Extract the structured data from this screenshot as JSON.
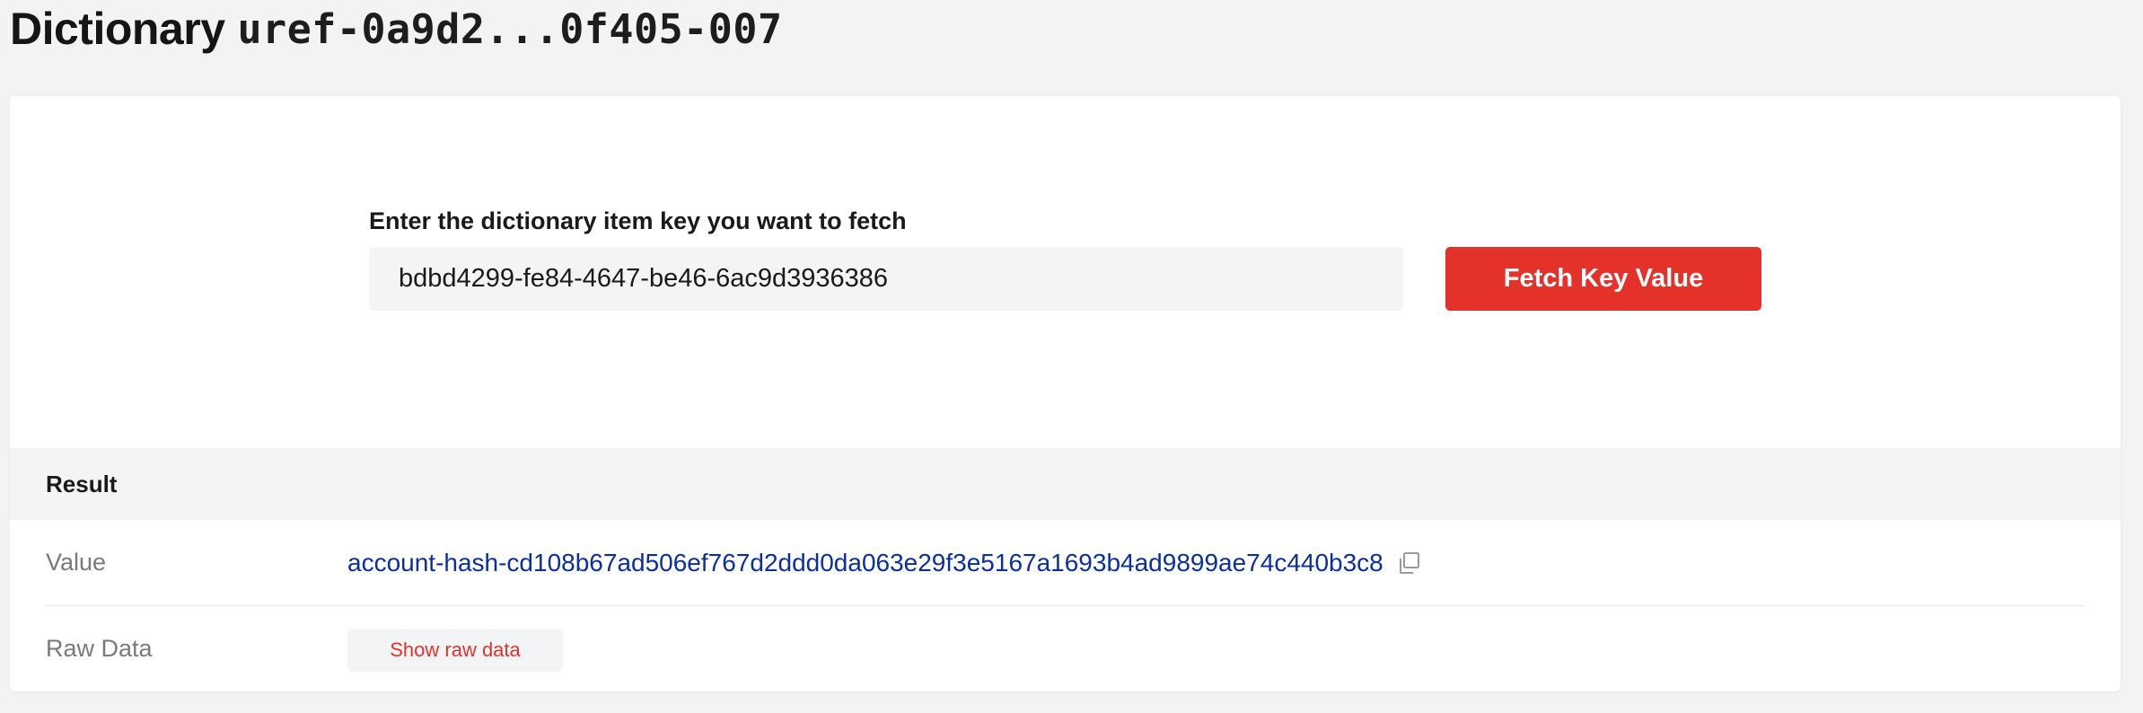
{
  "page": {
    "title_word": "Dictionary",
    "title_uref": "uref-0a9d2...0f405-007"
  },
  "fetch": {
    "label": "Enter the dictionary item key you want to fetch",
    "key_value": "bdbd4299-fe84-4647-be46-6ac9d3936386",
    "button_label": "Fetch Key Value"
  },
  "result": {
    "header": "Result",
    "value_label": "Value",
    "value": "account-hash-cd108b67ad506ef767d2ddd0da063e29f3e5167a1693b4ad9899ae74c440b3c8",
    "raw_label": "Raw Data",
    "raw_button_label": "Show raw data"
  },
  "icons": {
    "copy": "copy-icon"
  },
  "colors": {
    "accent": "#e4322b",
    "link": "#0a2fa0",
    "background": "#f2f3f5",
    "card": "#ffffff"
  }
}
